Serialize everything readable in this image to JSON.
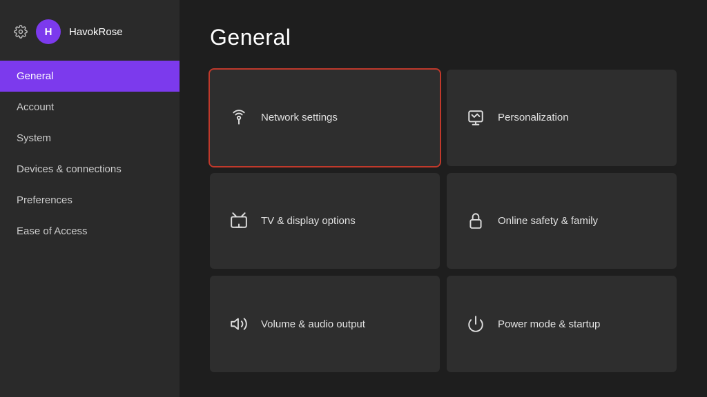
{
  "user": {
    "name": "HavokRose",
    "avatar_initials": "H"
  },
  "page": {
    "title": "General"
  },
  "sidebar": {
    "items": [
      {
        "id": "general",
        "label": "General",
        "active": true
      },
      {
        "id": "account",
        "label": "Account",
        "active": false
      },
      {
        "id": "system",
        "label": "System",
        "active": false
      },
      {
        "id": "devices",
        "label": "Devices & connections",
        "active": false
      },
      {
        "id": "preferences",
        "label": "Preferences",
        "active": false
      },
      {
        "id": "ease",
        "label": "Ease of Access",
        "active": false
      }
    ]
  },
  "tiles": [
    {
      "id": "network",
      "label": "Network settings",
      "icon": "network",
      "focused": true
    },
    {
      "id": "personalization",
      "label": "Personalization",
      "icon": "personalization",
      "focused": false
    },
    {
      "id": "tv-display",
      "label": "TV & display options",
      "icon": "tv",
      "focused": false
    },
    {
      "id": "online-safety",
      "label": "Online safety & family",
      "icon": "lock",
      "focused": false
    },
    {
      "id": "volume",
      "label": "Volume & audio output",
      "icon": "volume",
      "focused": false
    },
    {
      "id": "power",
      "label": "Power mode & startup",
      "icon": "power",
      "focused": false
    }
  ]
}
